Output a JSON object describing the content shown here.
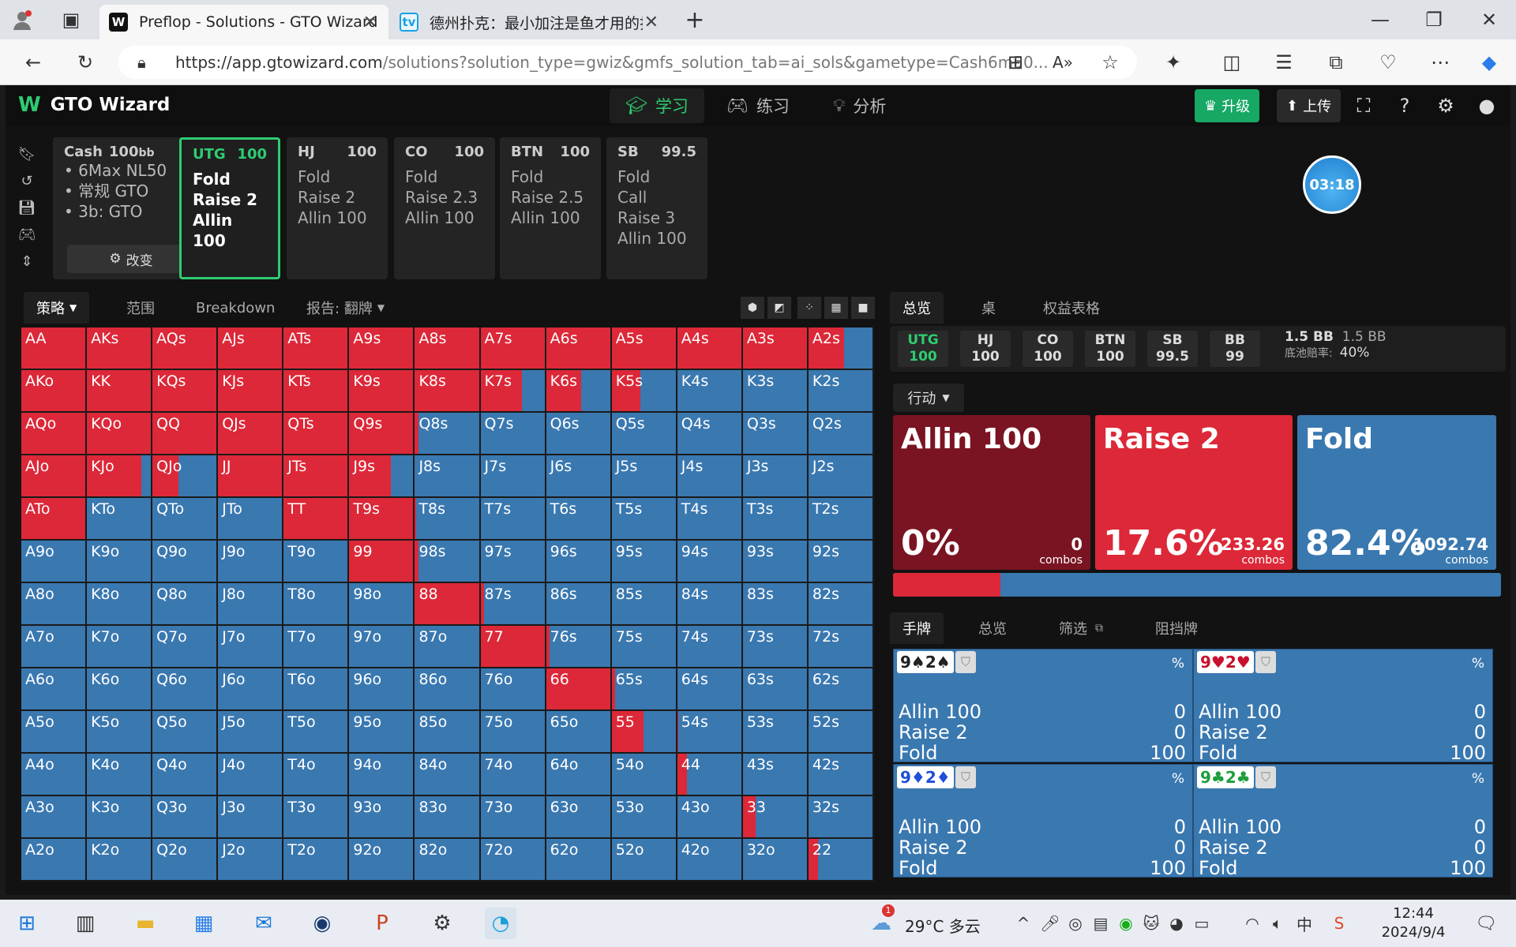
{
  "browser": {
    "tabs": [
      {
        "title": "Preflop - Solutions - GTO Wizard",
        "favicon": "W"
      },
      {
        "title": "德州扑克：最小加注是鱼才用的打",
        "favicon": "tv"
      }
    ],
    "url_main": "https://app.gtowizard.com",
    "url_rest": "/solutions?solution_type=gwiz&gmfs_solution_tab=ai_sols&gametype=Cash6m50..."
  },
  "app": {
    "logo": "GTO Wizard",
    "nav": [
      {
        "label": "学习",
        "icon": "graduation-cap-icon"
      },
      {
        "label": "练习",
        "icon": "gamepad-icon"
      },
      {
        "label": "分析",
        "icon": "lightbulb-icon"
      }
    ],
    "upgrade_label": "升级",
    "upload_label": "上传"
  },
  "game": {
    "title": "Cash",
    "stack": "100",
    "stack_unit": "bb",
    "lines": [
      "6Max NL50",
      "常规 GTO",
      "3b: GTO"
    ],
    "change_label": "改变"
  },
  "positions": [
    {
      "name": "UTG",
      "stack": "100",
      "actions": [
        "Fold",
        "Raise 2",
        "Allin 100"
      ]
    },
    {
      "name": "HJ",
      "stack": "100",
      "actions": [
        "Fold",
        "Raise 2",
        "Allin 100"
      ]
    },
    {
      "name": "CO",
      "stack": "100",
      "actions": [
        "Fold",
        "Raise 2.3",
        "Allin 100"
      ]
    },
    {
      "name": "BTN",
      "stack": "100",
      "actions": [
        "Fold",
        "Raise 2.5",
        "Allin 100"
      ]
    },
    {
      "name": "SB",
      "stack": "99.5",
      "actions": [
        "Fold",
        "Call",
        "Raise 3",
        "Allin 100"
      ]
    }
  ],
  "timer": "03:18",
  "strategy_tabs": [
    "策略",
    "范围",
    "Breakdown",
    "报告:",
    "翻牌"
  ],
  "grid": {
    "ranks": [
      "A",
      "K",
      "Q",
      "J",
      "T",
      "9",
      "8",
      "7",
      "6",
      "5",
      "4",
      "3",
      "2"
    ],
    "raise_freq": [
      [
        1,
        1,
        1,
        1,
        1,
        1,
        1,
        1,
        1,
        1,
        1,
        1,
        0.55
      ],
      [
        1,
        1,
        1,
        1,
        1,
        1,
        1,
        0.65,
        0.55,
        0.45,
        0,
        0,
        0
      ],
      [
        1,
        1,
        1,
        1,
        1,
        1,
        0.05,
        0,
        0,
        0,
        0,
        0,
        0
      ],
      [
        1,
        0.85,
        0.4,
        1,
        1,
        0.65,
        0,
        0,
        0,
        0,
        0,
        0,
        0
      ],
      [
        1,
        0,
        0,
        0,
        1,
        1,
        0.02,
        0,
        0,
        0,
        0,
        0,
        0
      ],
      [
        0,
        0,
        0,
        0,
        0,
        1,
        0.05,
        0,
        0,
        0,
        0,
        0,
        0
      ],
      [
        0,
        0,
        0,
        0,
        0,
        0,
        1,
        0.05,
        0,
        0,
        0,
        0,
        0
      ],
      [
        0,
        0,
        0,
        0,
        0,
        0,
        0,
        1,
        0.05,
        0,
        0,
        0,
        0
      ],
      [
        0,
        0,
        0,
        0,
        0,
        0,
        0,
        0,
        1,
        0.05,
        0,
        0,
        0
      ],
      [
        0,
        0,
        0,
        0,
        0,
        0,
        0,
        0,
        0,
        0.5,
        0.02,
        0,
        0
      ],
      [
        0,
        0,
        0,
        0,
        0,
        0,
        0,
        0,
        0,
        0,
        0.15,
        0,
        0
      ],
      [
        0,
        0,
        0,
        0,
        0,
        0,
        0,
        0,
        0,
        0,
        0,
        0.2,
        0
      ],
      [
        0,
        0,
        0,
        0,
        0,
        0,
        0,
        0,
        0,
        0,
        0,
        0,
        0.15
      ]
    ]
  },
  "overview_tabs": [
    "总览",
    "桌",
    "权益表格"
  ],
  "pos_chips": [
    {
      "name": "UTG",
      "stack": "100"
    },
    {
      "name": "HJ",
      "stack": "100"
    },
    {
      "name": "CO",
      "stack": "100"
    },
    {
      "name": "BTN",
      "stack": "100"
    },
    {
      "name": "SB",
      "stack": "99.5"
    },
    {
      "name": "BB",
      "stack": "99"
    }
  ],
  "pot": {
    "pot": "1.5 BB",
    "pot2": "1.5 BB",
    "odds_label": "底池赔率:",
    "odds": "40%"
  },
  "action_label": "行动",
  "actions": [
    {
      "name": "Allin 100",
      "pct": "0%",
      "combos": "0",
      "color": "#7a1422"
    },
    {
      "name": "Raise 2",
      "pct": "17.6%",
      "combos": "233.26",
      "color": "#dc2838"
    },
    {
      "name": "Fold",
      "pct": "82.4%",
      "combos": "1092.74",
      "color": "#3a78b0"
    }
  ],
  "combos_label": "combos",
  "raise_share": 0.176,
  "hand_tabs": [
    "手牌",
    "总览",
    "筛选",
    "阻挡牌"
  ],
  "hands": [
    {
      "cards": "9♠2♠",
      "color": "#222"
    },
    {
      "cards": "9♥2♥",
      "color": "#c8102e"
    },
    {
      "cards": "9♦2♦",
      "color": "#1f4fd8"
    },
    {
      "cards": "9♣2♣",
      "color": "#1e9e3e"
    }
  ],
  "hand_rows": [
    {
      "label": "Allin 100",
      "value": "0"
    },
    {
      "label": "Raise 2",
      "value": "0"
    },
    {
      "label": "Fold",
      "value": "100"
    }
  ],
  "pct_sign": "%",
  "taskbar": {
    "weather": "29°C 多云",
    "ime": "中",
    "time": "12:44",
    "date": "2024/9/4",
    "badge": "1"
  }
}
